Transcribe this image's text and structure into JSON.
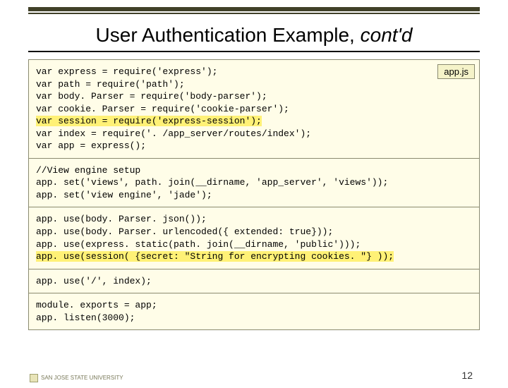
{
  "title_main": "User Authentication Example, ",
  "title_italic": "cont'd",
  "filename": "app.js",
  "page_number": "12",
  "logo_text": "SAN JOSE STATE\nUNIVERSITY",
  "code": {
    "block1_a": "var express = require('express');\nvar path = require('path');\nvar body. Parser = require('body-parser');\nvar cookie. Parser = require('cookie-parser');\n",
    "block1_hl": "var session = require('express-session');",
    "block1_b": "\nvar index = require('. /app_server/routes/index');\nvar app = express();",
    "block2": "//View engine setup\napp. set('views', path. join(__dirname, 'app_server', 'views'));\napp. set('view engine', 'jade');",
    "block3_a": "app. use(body. Parser. json());\napp. use(body. Parser. urlencoded({ extended: true}));\napp. use(express. static(path. join(__dirname, 'public')));\n",
    "block3_hl": "app. use(session( {secret: \"String for encrypting cookies. \"} ));",
    "block4": "app. use('/', index);",
    "block5": "module. exports = app;\napp. listen(3000);"
  }
}
